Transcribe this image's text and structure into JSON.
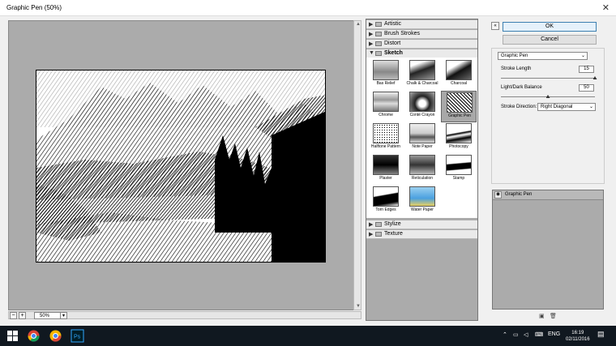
{
  "window": {
    "title": "Graphic Pen (50%)",
    "close_icon": "close-icon"
  },
  "preview": {
    "zoom_value": "50%",
    "zoom_out_icon": "minus-icon",
    "zoom_in_icon": "plus-icon"
  },
  "gallery": {
    "categories_top": [
      {
        "label": "Artistic",
        "expanded": false
      },
      {
        "label": "Brush Strokes",
        "expanded": false
      },
      {
        "label": "Distort",
        "expanded": false
      },
      {
        "label": "Sketch",
        "expanded": true
      }
    ],
    "sketch_filters": [
      {
        "label": "Bas Relief"
      },
      {
        "label": "Chalk & Charcoal"
      },
      {
        "label": "Charcoal"
      },
      {
        "label": "Chrome"
      },
      {
        "label": "Conté Crayon"
      },
      {
        "label": "Graphic Pen",
        "selected": true
      },
      {
        "label": "Halftone Pattern"
      },
      {
        "label": "Note Paper"
      },
      {
        "label": "Photocopy"
      },
      {
        "label": "Plaster"
      },
      {
        "label": "Reticulation"
      },
      {
        "label": "Stamp"
      },
      {
        "label": "Torn Edges"
      },
      {
        "label": "Water Paper"
      }
    ],
    "categories_bottom": [
      {
        "label": "Stylize",
        "expanded": false
      },
      {
        "label": "Texture",
        "expanded": false
      }
    ]
  },
  "buttons": {
    "ok": "OK",
    "cancel": "Cancel"
  },
  "settings": {
    "filter_select": "Graphic Pen",
    "stroke_length_label": "Stroke Length",
    "stroke_length_value": "15",
    "stroke_length_fraction": 1.0,
    "balance_label": "Light/Dark Balance",
    "balance_value": "50",
    "balance_fraction": 0.5,
    "direction_label": "Stroke Direction:",
    "direction_value": "Right Diagonal"
  },
  "layers": {
    "items": [
      {
        "label": "Graphic Pen"
      }
    ]
  },
  "taskbar": {
    "language": "ENG",
    "time": "16:19",
    "date": "02/11/2016"
  }
}
